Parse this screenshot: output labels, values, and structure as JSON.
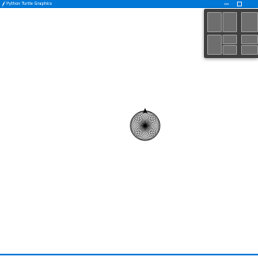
{
  "window": {
    "title": "Python Turtle Graphics",
    "controls": {
      "minimize_icon": "minimize-icon",
      "maximize_icon": "maximize-icon"
    },
    "accent_color": "#0078d7"
  },
  "canvas": {
    "background": "#ffffff",
    "drawing": {
      "shape": "spirograph-of-overlapping-circles",
      "circle_count": 36,
      "stroke_color": "#000000"
    },
    "turtle": {
      "icon": "turtle-arrow-icon",
      "heading": "up",
      "color": "#000000"
    }
  },
  "snap_layouts": {
    "background": "#3f3f3f",
    "layouts": [
      {
        "name": "two-columns"
      },
      {
        "name": "wide-left"
      },
      {
        "name": "grid-2x2-split-right"
      },
      {
        "name": "quad"
      }
    ]
  }
}
